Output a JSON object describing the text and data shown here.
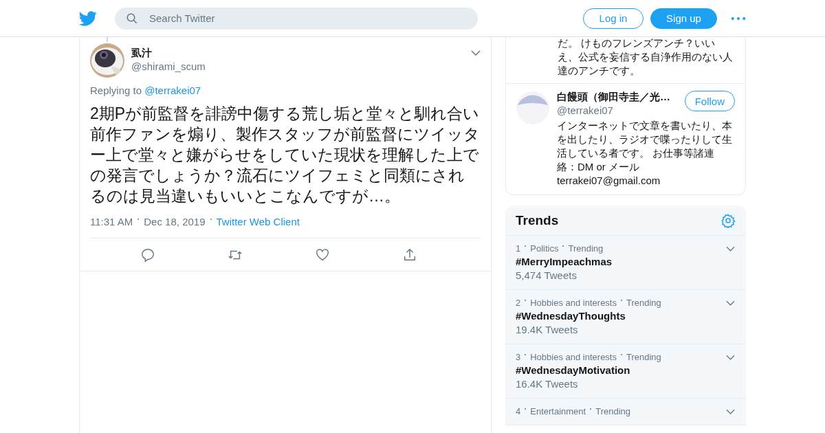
{
  "header": {
    "search": {
      "placeholder": "Search Twitter"
    },
    "buttons": [
      {
        "label": "Log in",
        "kind": "outline"
      },
      {
        "label": "Sign up",
        "kind": "filled"
      }
    ]
  },
  "tweet": {
    "name": "虱汁",
    "handle": "@shirami_scum",
    "replying_label": "Replying to",
    "replying_to": "@terrakei07",
    "text": "2期Pが前監督を誹謗中傷する荒し垢と堂々と馴れ合い前作ファンを煽り、製作スタッフが前監督にツイッター上で堂々と嫌がらせをしていた現状を理解した上での発言でしょうか？流石にツイフェミと同類にされるのは見当違いもいいとこなんですが…。",
    "time": "11:31 AM",
    "date": "Dec 18, 2019",
    "source": "Twitter Web Client"
  },
  "profile_card": {
    "bio_tail": "だ。 けものフレンズアンチ？いいえ、公式を妄信する自浄作用のない人達のアンチです。",
    "name": "白饅頭（御田寺圭／光…",
    "handle": "@terrakei07",
    "follow_label": "Follow",
    "bio": "インターネットで文章を書いたり、本を出したり、ラジオで喋ったりして生活している者です。 お仕事等諸連絡：DM or メール terrakei07@gmail.com"
  },
  "trends": {
    "title": "Trends",
    "items": [
      {
        "rank": "1",
        "category": "Politics",
        "status": "Trending",
        "tag": "#MerryImpeachmas",
        "count": "5,474 Tweets"
      },
      {
        "rank": "2",
        "category": "Hobbies and interests",
        "status": "Trending",
        "tag": "#WednesdayThoughts",
        "count": "19.4K Tweets"
      },
      {
        "rank": "3",
        "category": "Hobbies and interests",
        "status": "Trending",
        "tag": "#WednesdayMotivation",
        "count": "16.4K Tweets"
      },
      {
        "rank": "4",
        "category": "Entertainment",
        "status": "Trending"
      }
    ]
  }
}
